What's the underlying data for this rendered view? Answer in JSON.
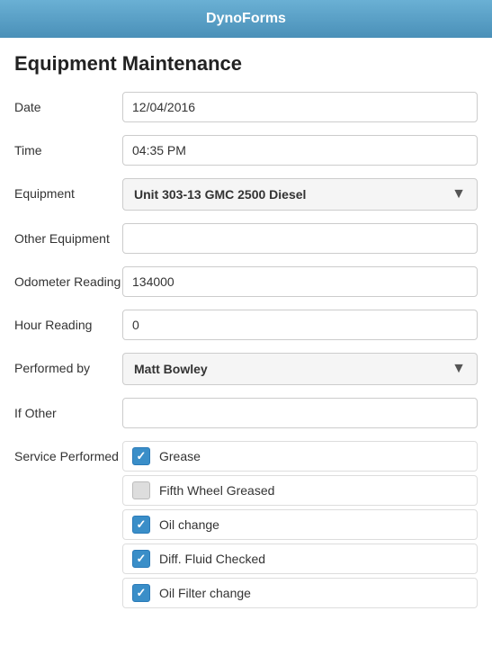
{
  "header": {
    "title": "DynoForms"
  },
  "page": {
    "title": "Equipment Maintenance"
  },
  "form": {
    "date_label": "Date",
    "date_value": "12/04/2016",
    "time_label": "Time",
    "time_value": "04:35 PM",
    "equipment_label": "Equipment",
    "equipment_value": "Unit 303-13 GMC 2500 Diesel",
    "other_equipment_label": "Other Equipment",
    "other_equipment_value": "",
    "odometer_label": "Odometer Reading",
    "odometer_value": "134000",
    "hour_label": "Hour Reading",
    "hour_value": "0",
    "performed_by_label": "Performed by",
    "performed_by_value": "Matt Bowley",
    "if_other_label": "If Other",
    "if_other_value": "",
    "service_label": "Service Performed",
    "services": [
      {
        "label": "Grease",
        "checked": true
      },
      {
        "label": "Fifth Wheel Greased",
        "checked": false
      },
      {
        "label": "Oil change",
        "checked": true
      },
      {
        "label": "Diff. Fluid Checked",
        "checked": true
      },
      {
        "label": "Oil Filter change",
        "checked": true
      }
    ]
  }
}
